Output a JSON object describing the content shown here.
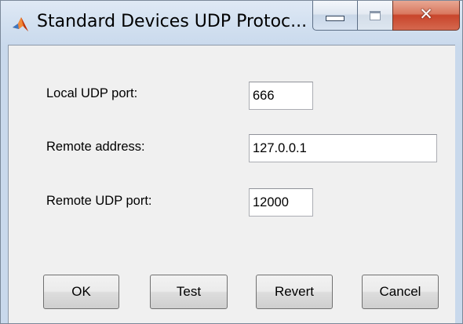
{
  "window": {
    "title": "Standard Devices UDP Protoc..."
  },
  "icons": {
    "app": "matlab-logo-icon",
    "minimize": "minimize-icon",
    "maximize": "maximize-icon",
    "close": "close-icon"
  },
  "form": {
    "local_port_label": "Local UDP port:",
    "local_port_value": "666",
    "remote_address_label": "Remote address:",
    "remote_address_value": "127.0.0.1",
    "remote_port_label": "Remote UDP port:",
    "remote_port_value": "12000"
  },
  "buttons": {
    "ok": "OK",
    "test": "Test",
    "revert": "Revert",
    "cancel": "Cancel"
  },
  "colors": {
    "close_button": "#c8452b",
    "client_background": "#f0f0f0",
    "title_bar": "#d2e0f0"
  }
}
